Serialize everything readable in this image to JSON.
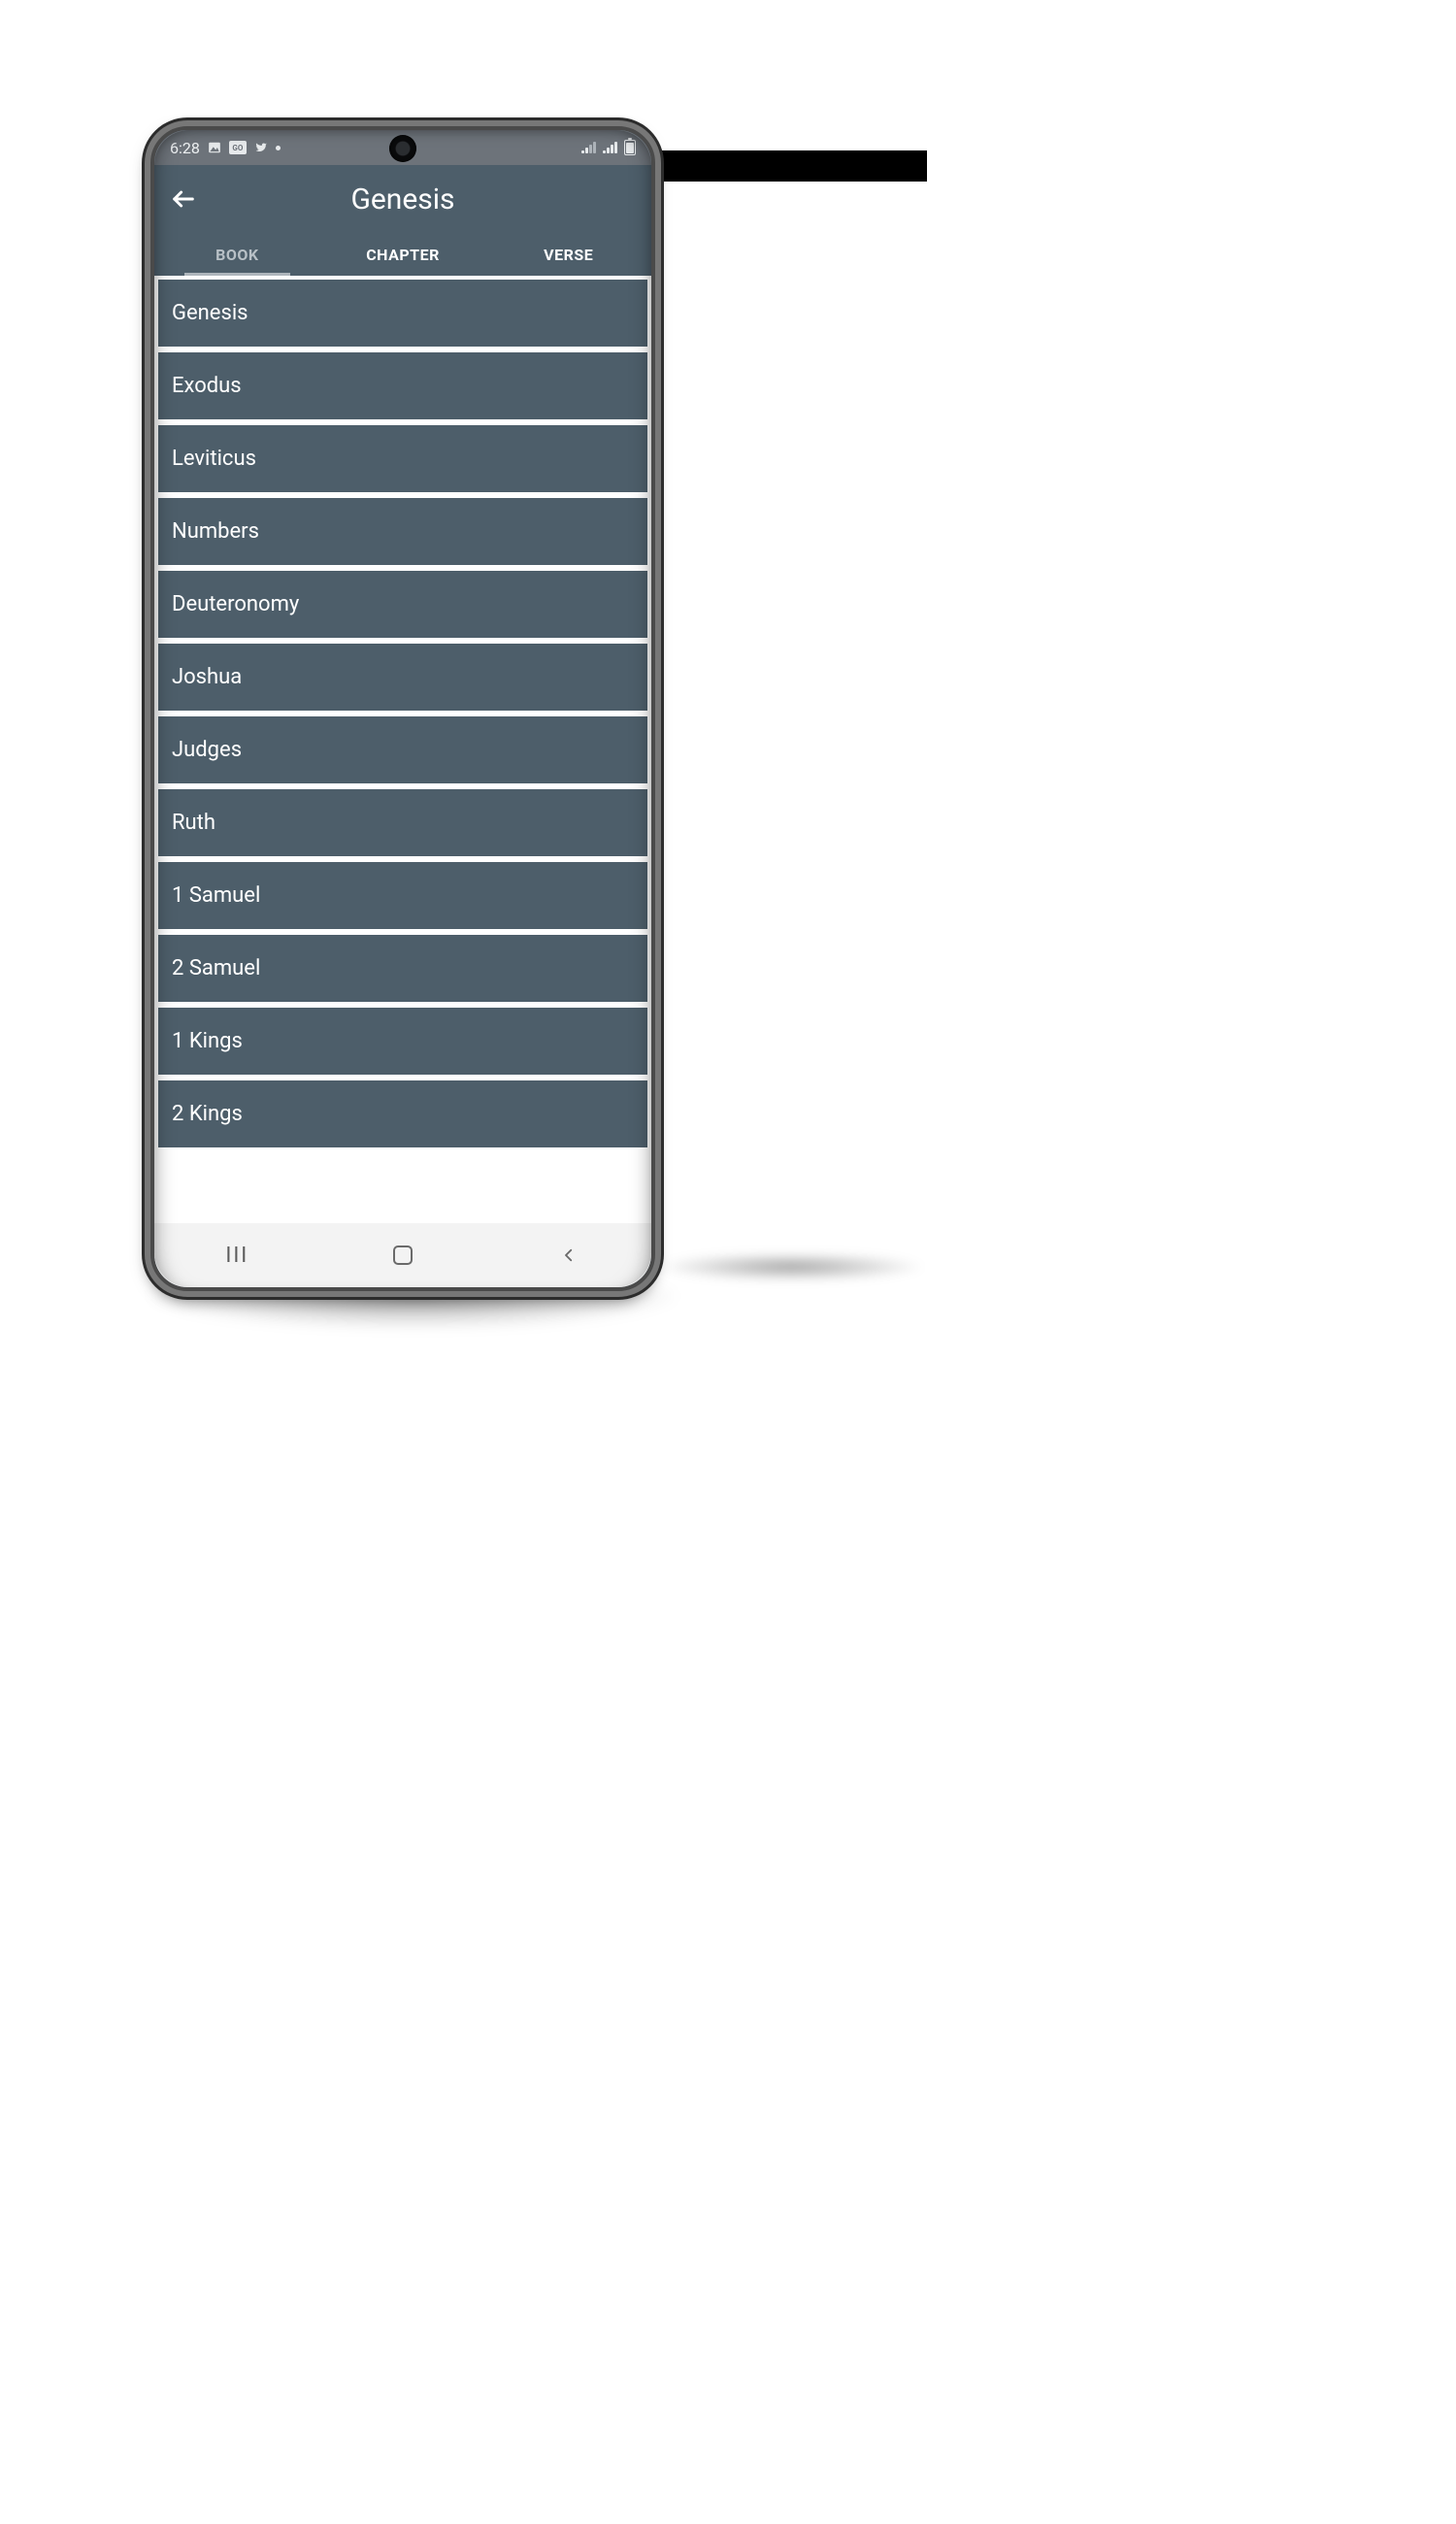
{
  "status": {
    "time": "6:28",
    "icons": {
      "image": "image-icon",
      "news": "GO",
      "twitter": "twitter-icon"
    }
  },
  "header": {
    "title": "Genesis"
  },
  "tabs": [
    {
      "label": "BOOK",
      "active": true
    },
    {
      "label": "CHAPTER",
      "active": false
    },
    {
      "label": "VERSE",
      "active": false
    }
  ],
  "books": [
    "Genesis",
    "Exodus",
    "Leviticus",
    "Numbers",
    "Deuteronomy",
    "Joshua",
    "Judges",
    "Ruth",
    "1 Samuel",
    "2 Samuel",
    "1 Kings",
    "2 Kings"
  ]
}
